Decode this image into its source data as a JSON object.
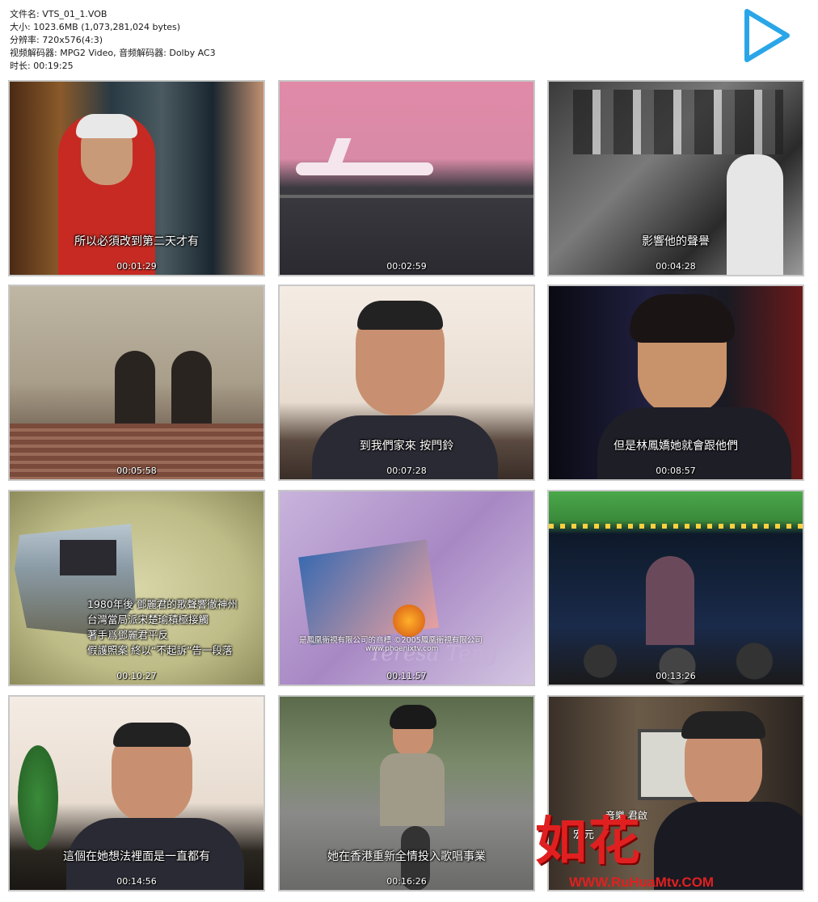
{
  "file_info": {
    "filename": "文件名: VTS_01_1.VOB",
    "size": "大小: 1023.6MB (1,073,281,024 bytes)",
    "resolution": "分辨率: 720x576(4:3)",
    "codec": "视频解码器: MPG2 Video, 音频解码器: Dolby AC3",
    "duration": "时长: 00:19:25"
  },
  "play_icon": "play-icon",
  "thumbnails": [
    {
      "time": "00:01:29",
      "subtitle": "所以必須改到第二天才有"
    },
    {
      "time": "00:02:59",
      "subtitle": ""
    },
    {
      "time": "00:04:28",
      "subtitle": "影響他的聲譽"
    },
    {
      "time": "00:05:58",
      "subtitle": ""
    },
    {
      "time": "00:07:28",
      "subtitle": "到我們家來 按門鈴"
    },
    {
      "time": "00:08:57",
      "subtitle": "但是林鳳嬌她就會跟他們"
    },
    {
      "time": "00:10:27",
      "subtitle": "",
      "caption_lines": [
        "1980年後 鄧麗君的歌聲響徹神州",
        "台灣當局派宋楚瑜積極接觸",
        "著手爲鄧麗君平反",
        "假護照案 終以“不起訴”告一段落"
      ]
    },
    {
      "time": "00:11:57",
      "subtitle": "",
      "overlay": "是鳳凰衛視有限公司的商標 ©2005鳳凰衛視有限公司",
      "url": "www.phoenixtv.com",
      "script": "Teresa Teng"
    },
    {
      "time": "00:13:26",
      "subtitle": ""
    },
    {
      "time": "00:14:56",
      "subtitle": "這個在她想法裡面是一直都有"
    },
    {
      "time": "00:16:26",
      "subtitle": "她在香港重新全情投入歌唱事業"
    },
    {
      "time": "00:17:55",
      "subtitle": "",
      "overlay": "宏元",
      "sign": "音樂 君啟"
    }
  ],
  "watermark": {
    "logo": "如花",
    "url": "WWW.RuHuaMtv.COM"
  },
  "colors": {
    "accent_play": "#2aa6e8",
    "watermark": "#e02020"
  }
}
